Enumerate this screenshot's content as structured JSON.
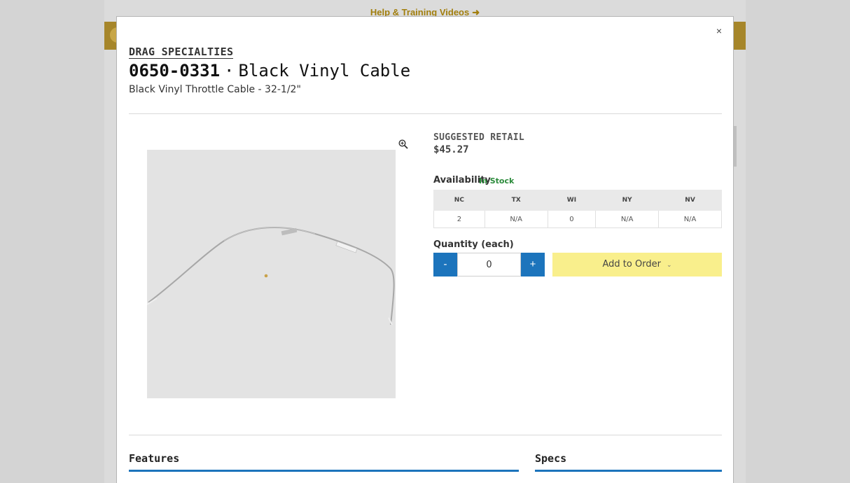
{
  "background": {
    "help_link": "Help & Training Videos",
    "accent_color": "#b5922e"
  },
  "modal": {
    "close_label": "×",
    "brand": "DRAG SPECIALTIES",
    "part_number": "0650-0331",
    "separator": "·",
    "product_name": "Black Vinyl Cable",
    "description": "Black Vinyl Throttle Cable - 32-1/2\"",
    "image_icon": "zoom-in-icon"
  },
  "pricing": {
    "label": "SUGGESTED RETAIL",
    "price": "$45.27"
  },
  "availability": {
    "label": "Availability",
    "status": "In Stock",
    "status_color": "#2a8a3a",
    "warehouses": [
      "NC",
      "TX",
      "WI",
      "NY",
      "NV"
    ],
    "quantities": [
      "2",
      "N/A",
      "0",
      "N/A",
      "N/A"
    ]
  },
  "quantity": {
    "label": "Quantity (each)",
    "minus": "-",
    "plus": "+",
    "value": "0"
  },
  "order": {
    "add_label": "Add to Order",
    "button_color": "#f9ef8c"
  },
  "sections": {
    "features": "Features",
    "specs": "Specs"
  }
}
